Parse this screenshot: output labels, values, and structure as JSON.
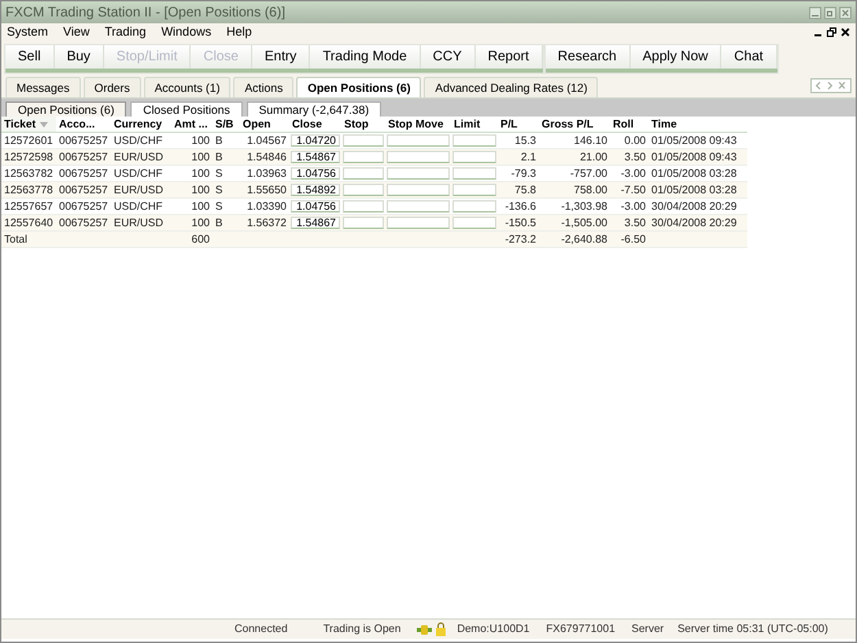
{
  "window": {
    "title": "FXCM Trading Station II - [Open Positions (6)]"
  },
  "menu": [
    "System",
    "View",
    "Trading",
    "Windows",
    "Help"
  ],
  "toolbar": [
    {
      "buttons": [
        {
          "label": "Sell",
          "disabled": false
        },
        {
          "label": "Buy",
          "disabled": false
        },
        {
          "label": "Stop/Limit",
          "disabled": true
        },
        {
          "label": "Close",
          "disabled": true
        },
        {
          "label": "Entry",
          "disabled": false
        },
        {
          "label": "Trading Mode",
          "disabled": false
        },
        {
          "label": "CCY",
          "disabled": false
        },
        {
          "label": "Report",
          "disabled": false
        }
      ]
    },
    {
      "buttons": [
        {
          "label": "Research",
          "disabled": false
        },
        {
          "label": "Apply Now",
          "disabled": false
        },
        {
          "label": "Chat",
          "disabled": false
        }
      ]
    }
  ],
  "tabs": [
    {
      "label": "Messages",
      "selected": false
    },
    {
      "label": "Orders",
      "selected": false
    },
    {
      "label": "Accounts (1)",
      "selected": false
    },
    {
      "label": "Actions",
      "selected": false
    },
    {
      "label": "Open Positions (6)",
      "selected": true
    },
    {
      "label": "Advanced Dealing Rates (12)",
      "selected": false
    }
  ],
  "subtabs": [
    {
      "label": "Open Positions (6)",
      "selected": true
    },
    {
      "label": "Closed Positions",
      "selected": false
    },
    {
      "label": "Summary (-2,647.38)",
      "selected": false
    }
  ],
  "table": {
    "columns": [
      {
        "label": "Ticket",
        "sorted": true
      },
      {
        "label": "Acco...",
        "sorted": false
      },
      {
        "label": "Currency",
        "sorted": false
      },
      {
        "label": "Amt ...",
        "sorted": false
      },
      {
        "label": "S/B",
        "sorted": false
      },
      {
        "label": "Open",
        "sorted": false
      },
      {
        "label": "Close",
        "sorted": false
      },
      {
        "label": "Stop",
        "sorted": false
      },
      {
        "label": "Stop Move",
        "sorted": false
      },
      {
        "label": "Limit",
        "sorted": false
      },
      {
        "label": "P/L",
        "sorted": false
      },
      {
        "label": "Gross P/L",
        "sorted": false
      },
      {
        "label": "Roll",
        "sorted": false
      },
      {
        "label": "Time",
        "sorted": false
      }
    ],
    "rows": [
      {
        "ticket": "12572601",
        "account": "00675257",
        "currency": "USD/CHF",
        "amount": "100",
        "side": "B",
        "open": "1.04567",
        "close": "1.04720",
        "pl": "15.3",
        "gross_pl": "146.10",
        "roll": "0.00",
        "time": "01/05/2008 09:43"
      },
      {
        "ticket": "12572598",
        "account": "00675257",
        "currency": "EUR/USD",
        "amount": "100",
        "side": "B",
        "open": "1.54846",
        "close": "1.54867",
        "pl": "2.1",
        "gross_pl": "21.00",
        "roll": "3.50",
        "time": "01/05/2008 09:43"
      },
      {
        "ticket": "12563782",
        "account": "00675257",
        "currency": "USD/CHF",
        "amount": "100",
        "side": "S",
        "open": "1.03963",
        "close": "1.04756",
        "pl": "-79.3",
        "gross_pl": "-757.00",
        "roll": "-3.00",
        "time": "01/05/2008 03:28"
      },
      {
        "ticket": "12563778",
        "account": "00675257",
        "currency": "EUR/USD",
        "amount": "100",
        "side": "S",
        "open": "1.55650",
        "close": "1.54892",
        "pl": "75.8",
        "gross_pl": "758.00",
        "roll": "-7.50",
        "time": "01/05/2008 03:28"
      },
      {
        "ticket": "12557657",
        "account": "00675257",
        "currency": "USD/CHF",
        "amount": "100",
        "side": "S",
        "open": "1.03390",
        "close": "1.04756",
        "pl": "-136.6",
        "gross_pl": "-1,303.98",
        "roll": "-3.00",
        "time": "30/04/2008 20:29"
      },
      {
        "ticket": "12557640",
        "account": "00675257",
        "currency": "EUR/USD",
        "amount": "100",
        "side": "B",
        "open": "1.56372",
        "close": "1.54867",
        "pl": "-150.5",
        "gross_pl": "-1,505.00",
        "roll": "3.50",
        "time": "30/04/2008 20:29"
      }
    ],
    "total": {
      "label": "Total",
      "amount": "600",
      "pl": "-273.2",
      "gross_pl": "-2,640.88",
      "roll": "-6.50"
    }
  },
  "status_bar": {
    "connection": "Connected",
    "trading": "Trading is Open",
    "account": "Demo:U100D1",
    "login": "FX679771001",
    "server": "Server",
    "server_time": "Server time 05:31 (UTC-05:00)"
  }
}
